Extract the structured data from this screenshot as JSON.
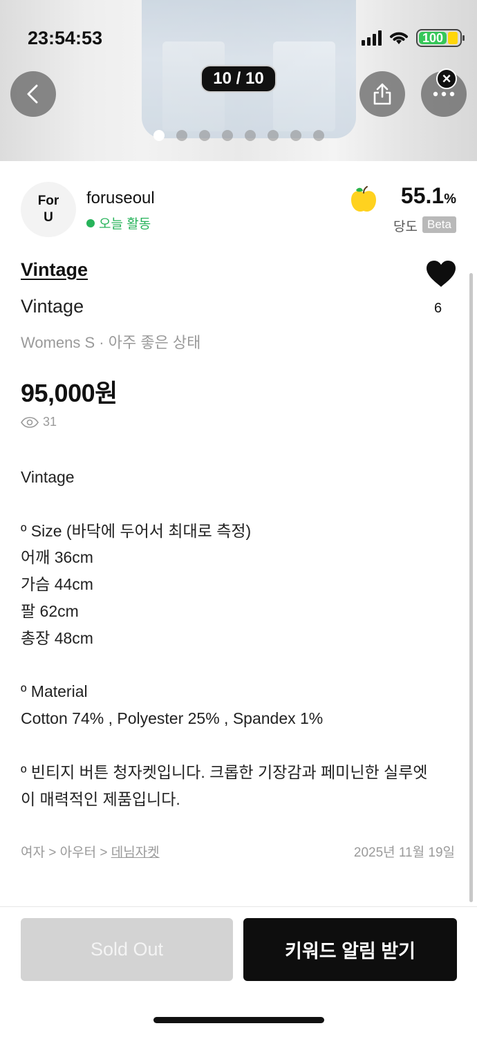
{
  "status_bar": {
    "time": "23:54:53",
    "battery": "100"
  },
  "gallery": {
    "counter": "10 / 10",
    "dot_count": 8,
    "active_dot": 0
  },
  "seller": {
    "avatar_line1": "For",
    "avatar_line2": "U",
    "name": "foruseoul",
    "activity": "오늘 활동",
    "temperature_value": "55.1",
    "temperature_unit": "%",
    "temperature_label": "당도",
    "beta_badge": "Beta"
  },
  "product": {
    "brand": "Vintage",
    "title": "Vintage",
    "meta": "Womens S · 아주 좋은 상태",
    "price": "95,000원",
    "views": "31",
    "likes": "6"
  },
  "description": [
    "Vintage",
    "",
    "º Size (바닥에 두어서 최대로 측정)",
    "어깨 36cm",
    "가슴 44cm",
    "팔 62cm",
    "총장 48cm",
    "",
    "º Material",
    "Cotton 74% , Polyester 25% , Spandex 1%",
    "",
    "º 빈티지 버튼 청자켓입니다. 크롭한 기장감과 페미닌한 실루엣",
    "이 매력적인 제품입니다."
  ],
  "category": {
    "path": "여자 > 아우터 > ",
    "leaf": "데님자켓"
  },
  "posted_date": "2025년 11월 19일",
  "actions": {
    "sold_out": "Sold Out",
    "keyword_alert": "키워드 알림 받기"
  },
  "colors": {
    "activity_green": "#27b35a",
    "sold_out_bg": "#d3d3d3",
    "primary_button_bg": "#0e0e0e"
  }
}
